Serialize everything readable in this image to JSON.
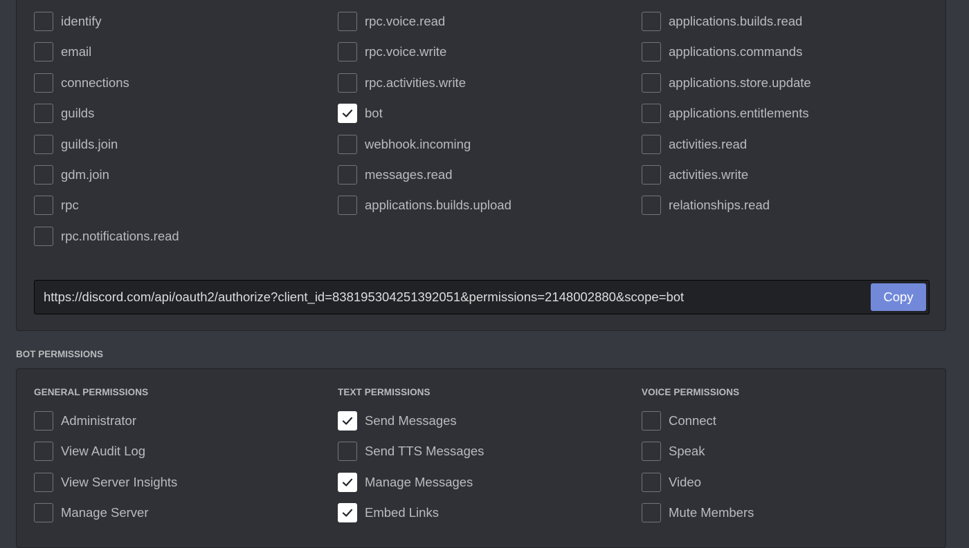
{
  "scopes": {
    "columns": [
      [
        {
          "label": "identify",
          "checked": false
        },
        {
          "label": "email",
          "checked": false
        },
        {
          "label": "connections",
          "checked": false
        },
        {
          "label": "guilds",
          "checked": false
        },
        {
          "label": "guilds.join",
          "checked": false
        },
        {
          "label": "gdm.join",
          "checked": false
        },
        {
          "label": "rpc",
          "checked": false
        },
        {
          "label": "rpc.notifications.read",
          "checked": false
        }
      ],
      [
        {
          "label": "rpc.voice.read",
          "checked": false
        },
        {
          "label": "rpc.voice.write",
          "checked": false
        },
        {
          "label": "rpc.activities.write",
          "checked": false
        },
        {
          "label": "bot",
          "checked": true
        },
        {
          "label": "webhook.incoming",
          "checked": false
        },
        {
          "label": "messages.read",
          "checked": false
        },
        {
          "label": "applications.builds.upload",
          "checked": false
        }
      ],
      [
        {
          "label": "applications.builds.read",
          "checked": false
        },
        {
          "label": "applications.commands",
          "checked": false
        },
        {
          "label": "applications.store.update",
          "checked": false
        },
        {
          "label": "applications.entitlements",
          "checked": false
        },
        {
          "label": "activities.read",
          "checked": false
        },
        {
          "label": "activities.write",
          "checked": false
        },
        {
          "label": "relationships.read",
          "checked": false
        }
      ]
    ]
  },
  "generated_url": {
    "value": "https://discord.com/api/oauth2/authorize?client_id=838195304251392051&permissions=2148002880&scope=bot",
    "copy_label": "Copy"
  },
  "bot_permissions": {
    "heading": "BOT PERMISSIONS",
    "columns": [
      {
        "title": "GENERAL PERMISSIONS",
        "items": [
          {
            "label": "Administrator",
            "checked": false
          },
          {
            "label": "View Audit Log",
            "checked": false
          },
          {
            "label": "View Server Insights",
            "checked": false
          },
          {
            "label": "Manage Server",
            "checked": false
          }
        ]
      },
      {
        "title": "TEXT PERMISSIONS",
        "items": [
          {
            "label": "Send Messages",
            "checked": true
          },
          {
            "label": "Send TTS Messages",
            "checked": false
          },
          {
            "label": "Manage Messages",
            "checked": true
          },
          {
            "label": "Embed Links",
            "checked": true
          }
        ]
      },
      {
        "title": "VOICE PERMISSIONS",
        "items": [
          {
            "label": "Connect",
            "checked": false
          },
          {
            "label": "Speak",
            "checked": false
          },
          {
            "label": "Video",
            "checked": false
          },
          {
            "label": "Mute Members",
            "checked": false
          }
        ]
      }
    ]
  },
  "colors": {
    "background": "#36393f",
    "panel": "#2f3136",
    "accent": "#7289da",
    "checked_box": "#ffffff"
  }
}
